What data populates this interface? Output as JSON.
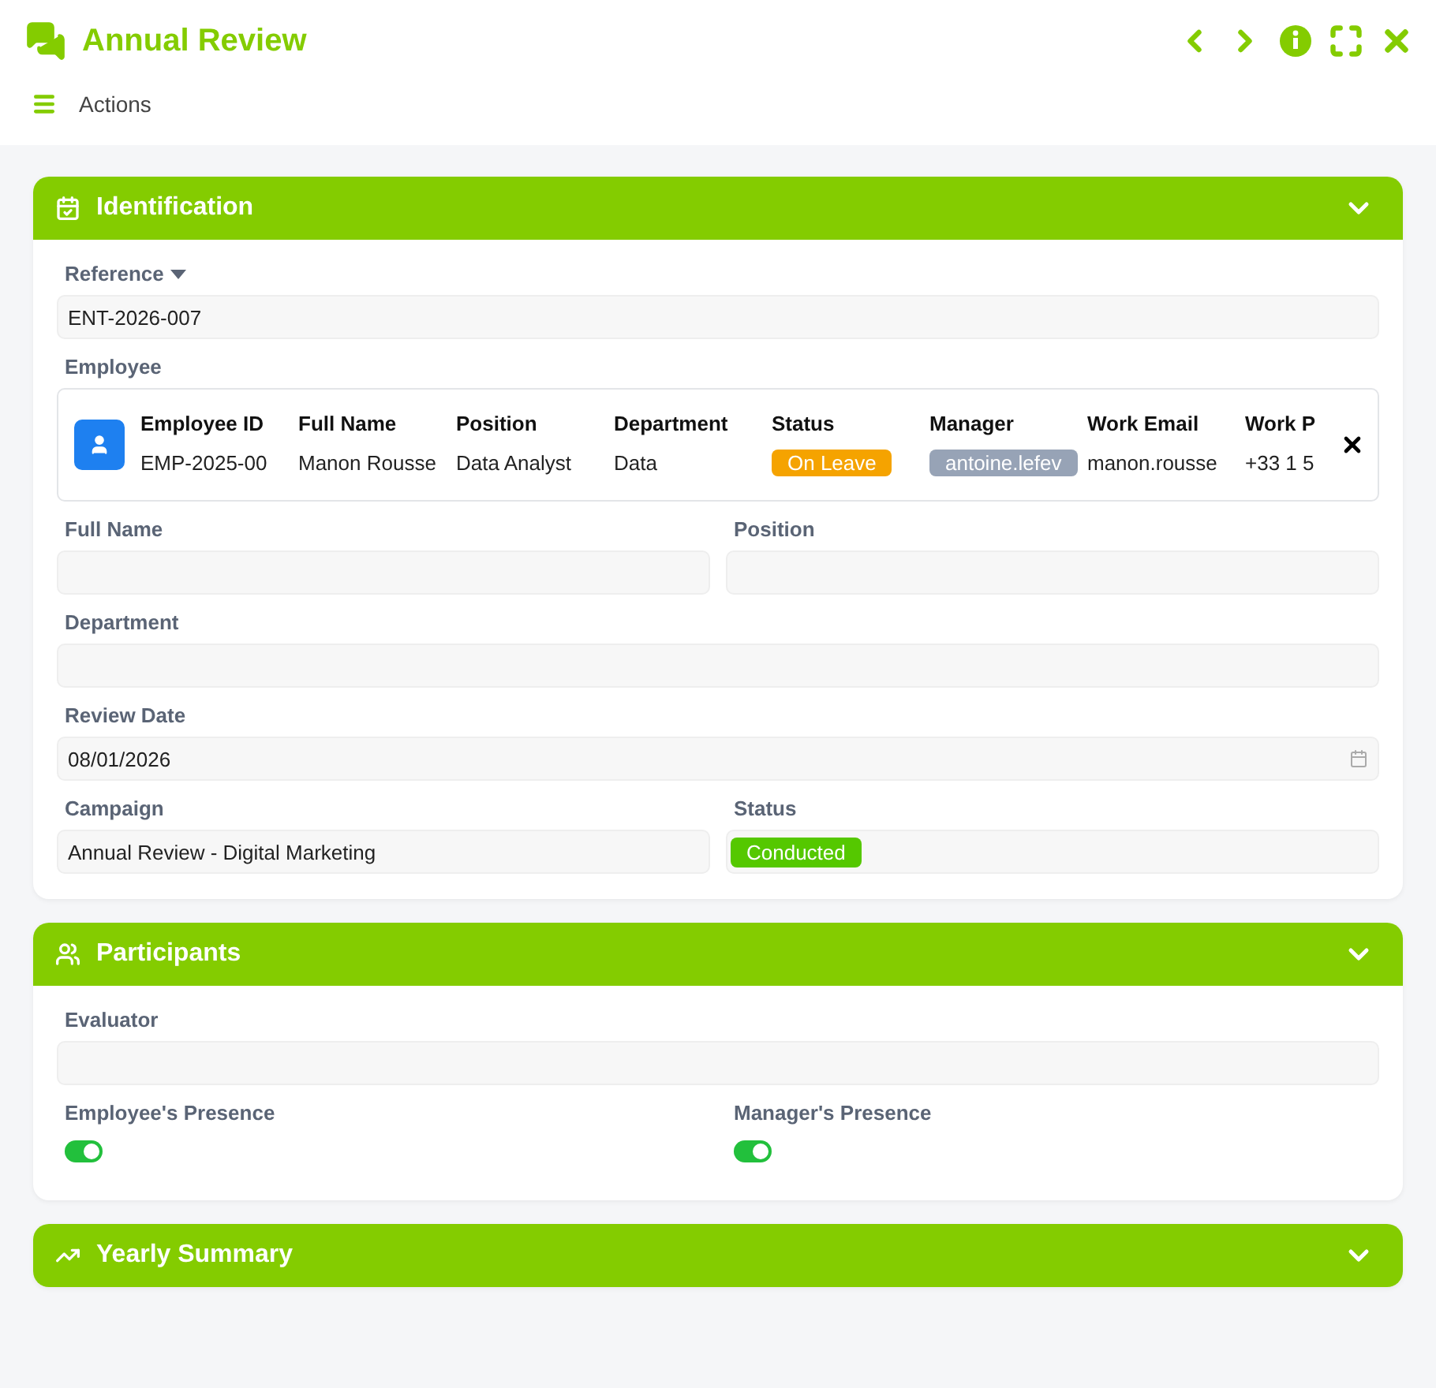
{
  "window": {
    "title": "Annual Review"
  },
  "toolbar": {
    "label": "Actions"
  },
  "sections": [
    {
      "title": "Identification",
      "rows": [
        [
          {
            "kind": "select",
            "label": "Reference",
            "value": "ENT-2026-007"
          }
        ],
        [
          {
            "kind": "record",
            "label": "Employee",
            "columns": [
              {
                "heading": "Employee ID",
                "value": "EMP-2025-00"
              },
              {
                "heading": "Full Name",
                "value": "Manon Rousse"
              },
              {
                "heading": "Position",
                "value": "Data Analyst"
              },
              {
                "heading": "Department",
                "value": "Data"
              },
              {
                "heading": "Status",
                "value": "On Leave",
                "color": "#f5a300"
              },
              {
                "heading": "Manager",
                "value": "antoine.lefev",
                "color": "#97a3b6"
              },
              {
                "heading": "Work Email",
                "value": "manon.rousse"
              },
              {
                "heading": "Work P",
                "value": "+33 1 5"
              }
            ]
          }
        ],
        [
          {
            "kind": "text",
            "label": "Full Name"
          },
          {
            "kind": "text",
            "label": "Position"
          }
        ],
        [
          {
            "kind": "text",
            "label": "Department"
          }
        ],
        [
          {
            "kind": "date",
            "label": "Review Date",
            "value": "08/01/2026"
          }
        ],
        [
          {
            "kind": "text",
            "label": "Campaign",
            "value": "Annual Review - Digital Marketing"
          },
          {
            "kind": "badge",
            "label": "Status",
            "value": "Conducted",
            "color": "#55c800"
          }
        ]
      ]
    },
    {
      "title": "Participants",
      "rows": [
        [
          {
            "kind": "text",
            "label": "Evaluator"
          }
        ],
        [
          {
            "kind": "toggle",
            "label": "Employee's Presence",
            "on": true
          },
          {
            "kind": "toggle",
            "label": "Manager's Presence",
            "on": true
          }
        ]
      ]
    },
    {
      "title": "Yearly Summary"
    }
  ]
}
